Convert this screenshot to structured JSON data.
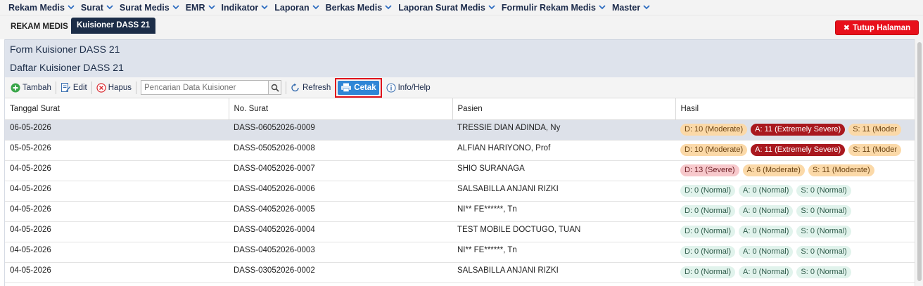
{
  "nav": {
    "items": [
      "Rekam Medis",
      "Surat",
      "Surat Medis",
      "EMR",
      "Indikator",
      "Laporan",
      "Berkas Medis",
      "Laporan Surat Medis",
      "Formulir Rekam Medis",
      "Master"
    ]
  },
  "tabs": {
    "static_label": "REKAM MEDIS",
    "active_label": "Kuisioner DASS 21",
    "close_label": "Tutup Halaman"
  },
  "panel": {
    "form_title": "Form Kuisioner DASS 21",
    "list_title": "Daftar Kuisioner DASS 21"
  },
  "toolbar": {
    "add_label": "Tambah",
    "edit_label": "Edit",
    "delete_label": "Hapus",
    "search_placeholder": "Pencarian Data Kuisioner",
    "refresh_label": "Refresh",
    "print_label": "Cetak",
    "help_label": "Info/Help"
  },
  "table": {
    "headers": [
      "Tanggal Surat",
      "No. Surat",
      "Pasien",
      "Hasil"
    ],
    "rows": [
      {
        "date": "06-05-2026",
        "no": "DASS-06052026-0009",
        "patient": "TRESSIE DIAN ADINDA, Ny",
        "selected": true,
        "results": [
          {
            "text": "D: 10 (Moderate)",
            "level": "moderate"
          },
          {
            "text": "A: 11 (Extremely Severe)",
            "level": "extreme"
          },
          {
            "text": "S: 11 (Moder",
            "level": "moderate"
          }
        ]
      },
      {
        "date": "05-05-2026",
        "no": "DASS-05052026-0008",
        "patient": "ALFIAN HARIYONO, Prof",
        "selected": false,
        "results": [
          {
            "text": "D: 10 (Moderate)",
            "level": "moderate"
          },
          {
            "text": "A: 11 (Extremely Severe)",
            "level": "extreme"
          },
          {
            "text": "S: 11 (Moder",
            "level": "moderate"
          }
        ]
      },
      {
        "date": "04-05-2026",
        "no": "DASS-04052026-0007",
        "patient": "SHIO SURANAGA",
        "selected": false,
        "results": [
          {
            "text": "D: 13 (Severe)",
            "level": "severe"
          },
          {
            "text": "A: 6 (Moderate)",
            "level": "moderate"
          },
          {
            "text": "S: 11 (Moderate)",
            "level": "moderate"
          }
        ]
      },
      {
        "date": "04-05-2026",
        "no": "DASS-04052026-0006",
        "patient": "SALSABILLA ANJANI RIZKI",
        "selected": false,
        "results": [
          {
            "text": "D: 0 (Normal)",
            "level": "normal"
          },
          {
            "text": "A: 0 (Normal)",
            "level": "normal"
          },
          {
            "text": "S: 0 (Normal)",
            "level": "normal"
          }
        ]
      },
      {
        "date": "04-05-2026",
        "no": "DASS-04052026-0005",
        "patient": "NI** FE******, Tn",
        "selected": false,
        "results": [
          {
            "text": "D: 0 (Normal)",
            "level": "normal"
          },
          {
            "text": "A: 0 (Normal)",
            "level": "normal"
          },
          {
            "text": "S: 0 (Normal)",
            "level": "normal"
          }
        ]
      },
      {
        "date": "04-05-2026",
        "no": "DASS-04052026-0004",
        "patient": "TEST MOBILE DOCTUGO, TUAN",
        "selected": false,
        "results": [
          {
            "text": "D: 0 (Normal)",
            "level": "normal"
          },
          {
            "text": "A: 0 (Normal)",
            "level": "normal"
          },
          {
            "text": "S: 0 (Normal)",
            "level": "normal"
          }
        ]
      },
      {
        "date": "04-05-2026",
        "no": "DASS-04052026-0003",
        "patient": "NI** FE******, Tn",
        "selected": false,
        "results": [
          {
            "text": "D: 0 (Normal)",
            "level": "normal"
          },
          {
            "text": "A: 0 (Normal)",
            "level": "normal"
          },
          {
            "text": "S: 0 (Normal)",
            "level": "normal"
          }
        ]
      },
      {
        "date": "04-05-2026",
        "no": "DASS-03052026-0002",
        "patient": "SALSABILLA ANJANI RIZKI",
        "selected": false,
        "results": [
          {
            "text": "D: 0 (Normal)",
            "level": "normal"
          },
          {
            "text": "A: 0 (Normal)",
            "level": "normal"
          },
          {
            "text": "S: 0 (Normal)",
            "level": "normal"
          }
        ]
      }
    ]
  },
  "icons": {
    "nav_chevron": "chevron-down-icon",
    "add": "plus-circle-icon",
    "edit": "edit-document-icon",
    "delete": "x-circle-icon",
    "search": "search-icon",
    "refresh": "refresh-icon",
    "print": "printer-icon",
    "help": "info-icon",
    "close": "close-icon"
  },
  "colors": {
    "nav_text": "#1b2a4a",
    "active_tab": "#1c2d48",
    "close_button": "#e8101b",
    "panel_header": "#dee3ec",
    "print_button": "#2f86d6",
    "highlight_box": "#e0131b",
    "selected_row": "#dde1e9",
    "badge_normal": "#e1f3ec",
    "badge_moderate": "#fbd9a8",
    "badge_severe": "#f7c9cc",
    "badge_extreme": "#a9181e"
  }
}
